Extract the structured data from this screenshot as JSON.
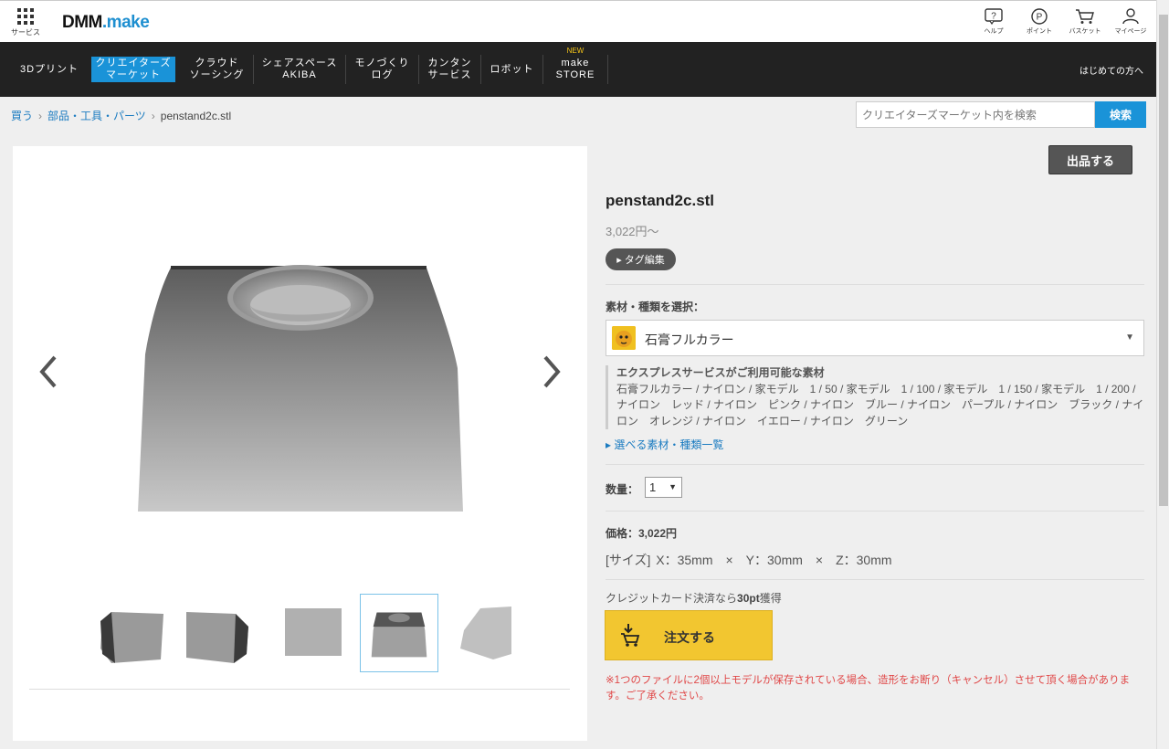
{
  "header": {
    "services_label": "サービス",
    "logo_left": "DMM",
    "logo_right": ".make",
    "tools": [
      {
        "icon": "help-icon",
        "label": "ヘルプ"
      },
      {
        "icon": "point-icon",
        "label": "ポイント"
      },
      {
        "icon": "cart-icon",
        "label": "バスケット"
      },
      {
        "icon": "user-icon",
        "label": "マイページ"
      }
    ]
  },
  "nav": {
    "items": [
      {
        "label": "3Dプリント"
      },
      {
        "label": "クリエイターズ\nマーケット",
        "active": true
      },
      {
        "label": "クラウド\nソーシング"
      },
      {
        "label": "シェアスペース\nAKIBA"
      },
      {
        "label": "モノづくり\nログ"
      },
      {
        "label": "カンタン\nサービス"
      },
      {
        "label": "ロボット"
      },
      {
        "label": "make\nSTORE",
        "badge": "NEW"
      }
    ],
    "first_time": "はじめての方へ"
  },
  "breadcrumb": {
    "items": [
      "買う",
      "部品・工具・パーツ"
    ],
    "current": "penstand2c.stl"
  },
  "search": {
    "placeholder": "クリエイターズマーケット内を検索",
    "button": "検索"
  },
  "product": {
    "list_button": "出品する",
    "title": "penstand2c.stl",
    "price_from": "3,022円～",
    "tag_button": "タグ編集",
    "material_label": "素材・種類を選択：",
    "material_selected": "石膏フルカラー",
    "express_title": "エクスプレスサービスがご利用可能な素材",
    "express_text": "石膏フルカラー / ナイロン / 家モデル　1 / 50 / 家モデル　1 / 100 / 家モデル　1 / 150 / 家モデル　1 / 200 / ナイロン　レッド / ナイロン　ピンク / ナイロン　ブルー / ナイロン　パープル / ナイロン　ブラック / ナイロン　オレンジ / ナイロン　イエロー / ナイロン　グリーン",
    "materials_link": "選べる素材・種類一覧",
    "qty_label": "数量：",
    "qty_value": "1",
    "price_label": "価格：3,022円",
    "size_text": "[サイズ] X：35mm　×　Y：30mm　×　Z：30mm",
    "credit_prefix": "クレジットカード決済なら",
    "credit_points": "30pt",
    "credit_suffix": "獲得",
    "order_button": "注文する",
    "warning": "※1つのファイルに2個以上モデルが保存されている場合、造形をお断り（キャンセル）させて頂く場合があります。ご了承ください。"
  },
  "colors": {
    "accent_blue": "#1a93d8",
    "nav_bg": "#222222",
    "order_yellow": "#f2c630",
    "warning_red": "#e04848"
  }
}
